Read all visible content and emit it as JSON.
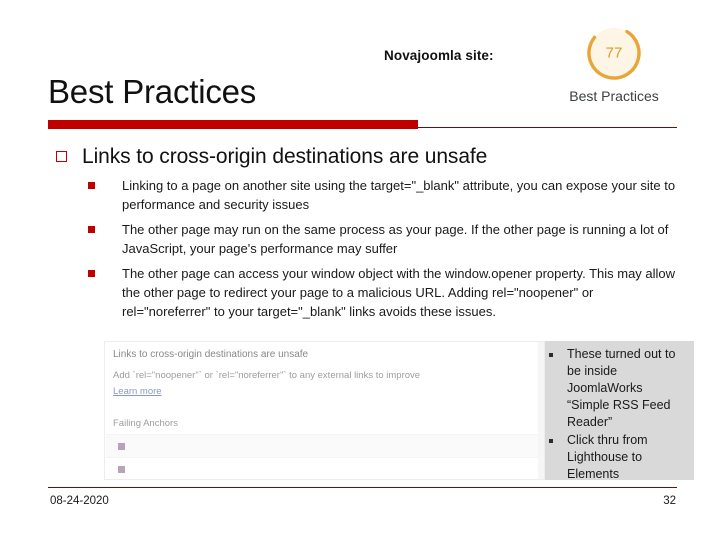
{
  "header": {
    "kicker": "Novajoomla site:",
    "title": "Best Practices"
  },
  "score_card": {
    "value": "77",
    "label": "Best Practices",
    "ring_color": "#E8A63A",
    "fill_color": "#FDF5E6"
  },
  "content": {
    "main_bullet": "Links to cross-origin destinations are unsafe",
    "sub_bullets": [
      "Linking to a page on another site using the target=\"_blank\" attribute, you can expose your site to performance and security issues",
      "The other page may run on the same process as your page. If the other page is running a lot of JavaScript, your page's performance may suffer",
      "The other page can access your window object with the window.opener property. This may allow the other page to redirect your page to a malicious URL. Adding rel=\"noopener\" or rel=\"noreferrer\" to your target=\"_blank\" links avoids these issues."
    ]
  },
  "screenshot": {
    "audit_title": "Links to cross-origin destinations are unsafe",
    "audit_desc": "Add `rel=\"noopener\"` or `rel=\"noreferrer\"` to any external links to improve",
    "learn_more": "Learn more",
    "table_heading": "Failing Anchors"
  },
  "notes": {
    "items": [
      "These turned out to be inside JoomlaWorks “Simple RSS Feed Reader”",
      "Click thru from Lighthouse to Elements"
    ]
  },
  "footer": {
    "date": "08-24-2020",
    "page_number": "32",
    "rule_color": "#6B0E0E"
  },
  "theme": {
    "accent_red": "#C00000",
    "dark_red": "#6B0E0E",
    "note_panel_bg": "#D9D9D9"
  }
}
